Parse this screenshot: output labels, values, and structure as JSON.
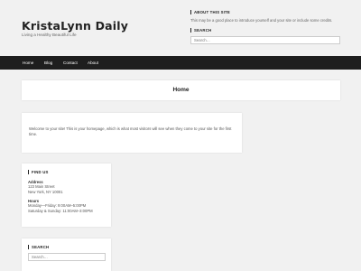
{
  "header": {
    "site_title": "KristaLynn Daily",
    "tagline": "Living a Healthy Beautiful Life",
    "about": {
      "title": "ABOUT THIS SITE",
      "text": "This may be a good place to introduce yourself and your site or include some credits."
    },
    "search": {
      "title": "SEARCH",
      "placeholder": "Search…"
    }
  },
  "nav": {
    "items": [
      "Home",
      "Blog",
      "Contact",
      "About"
    ]
  },
  "page": {
    "title": "Home",
    "content": "Welcome to your site! This is your homepage, which is what most visitors will see when they come to your site for the first time."
  },
  "sidebar": {
    "find_us": {
      "title": "FIND US",
      "address_label": "Address",
      "address_line1": "123 Main Street",
      "address_line2": "New York, NY 10001",
      "hours_label": "Hours",
      "hours_line1": "Monday—Friday: 9:00AM–5:00PM",
      "hours_line2": "Saturday & Sunday: 11:00AM–3:00PM"
    },
    "search": {
      "title": "SEARCH",
      "placeholder": "Search…"
    }
  },
  "colors": {
    "background": "#f1f1f1",
    "nav_background": "#1e1e1e",
    "panel_background": "#ffffff",
    "title_text": "#222222"
  }
}
